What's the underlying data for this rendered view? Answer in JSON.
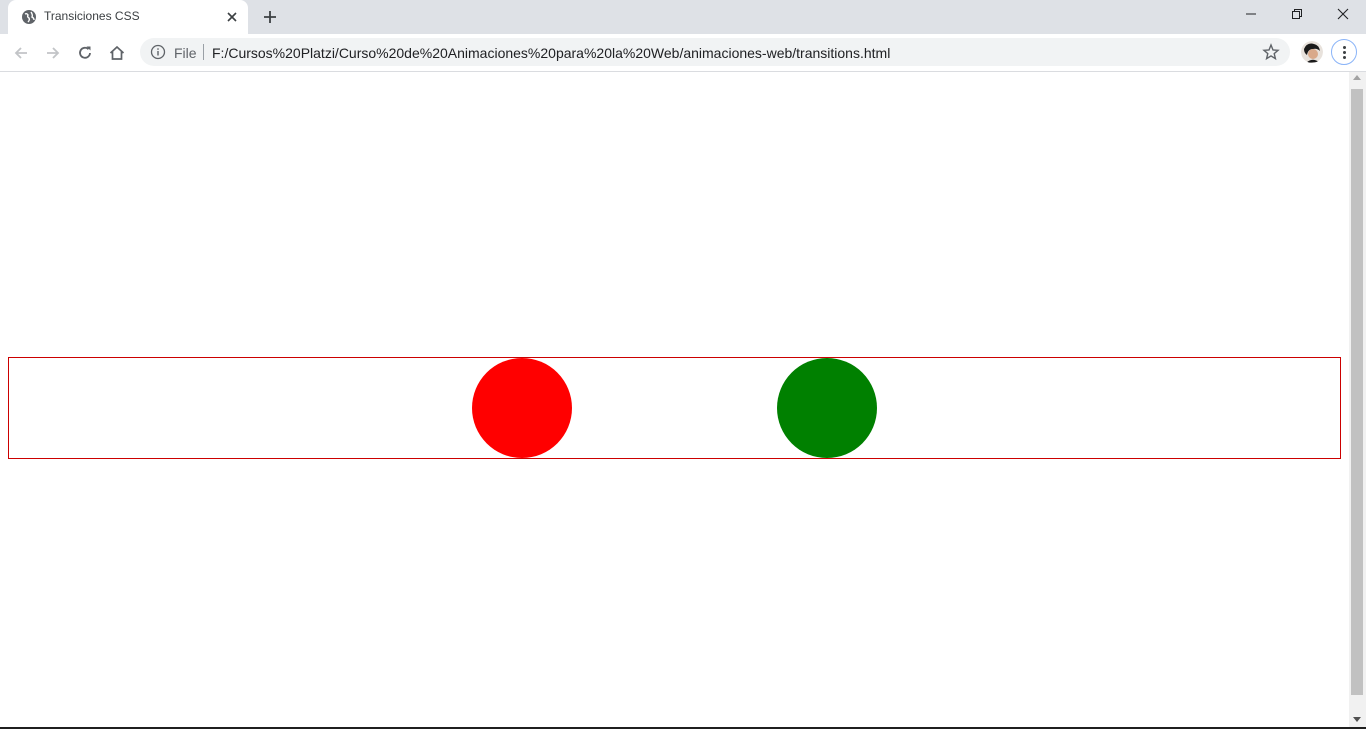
{
  "browser": {
    "tab": {
      "title": "Transiciones CSS",
      "favicon": "globe-icon"
    },
    "new_tab_icon": "plus-icon",
    "window_controls": [
      "minimize-icon",
      "restore-icon",
      "close-icon"
    ]
  },
  "toolbar": {
    "nav_icons": [
      "back-arrow-icon",
      "forward-arrow-icon",
      "reload-icon",
      "home-icon"
    ],
    "omnibox": {
      "info_icon": "info-icon",
      "scheme_label": "File",
      "url": "F:/Cursos%20Platzi/Curso%20de%20Animaciones%20para%20la%20Web/animaciones-web/transitions.html"
    },
    "bookmark_icon": "star-icon",
    "profile_icon": "avatar",
    "menu_icon": "kebab-menu-icon"
  },
  "page": {
    "container_border_color": "#cc0000",
    "balls": [
      {
        "name": "red-ball",
        "color": "#ff0000"
      },
      {
        "name": "green-ball",
        "color": "#008000"
      }
    ]
  }
}
